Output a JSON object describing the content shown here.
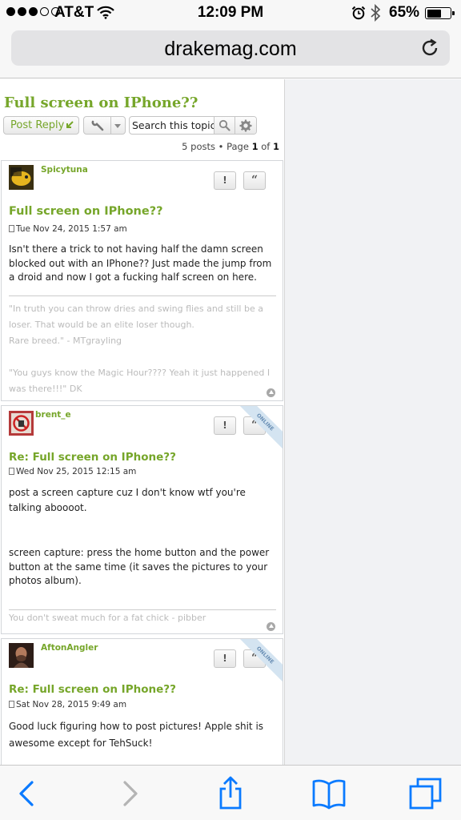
{
  "status_bar": {
    "carrier": "AT&T",
    "time": "12:09 PM",
    "battery_pct": "65%",
    "battery_level": 0.65,
    "signal_bars": 3,
    "signal_total": 5
  },
  "browser": {
    "url": "drakemag.com",
    "reload_icon": "reload-icon"
  },
  "topic": {
    "title": "Full screen on IPhone??",
    "post_reply": "Post Reply",
    "search_placeholder": "Search this topic…",
    "pagination": {
      "posts_text": "5 posts • Page ",
      "page": "1",
      "of_text": " of ",
      "total": "1"
    }
  },
  "report_label": "!",
  "quote_label": "“",
  "online_label": "ONLINE",
  "posts": [
    {
      "author": "Spicytuna",
      "title": "Full screen on IPhone??",
      "date": "Tue Nov 24, 2015 1:57 am",
      "body": [
        "Isn't there a trick to not having half the damn screen blocked out with an IPhone?? Just made the jump from a droid and now I got a fucking half screen on here."
      ],
      "signature": [
        "\"In truth you can throw dries and swing flies and still be a loser. That would be an elite loser though.",
        "Rare breed.\" - MTgrayling",
        "",
        "\"You guys know the Magic Hour???? Yeah it just happened I was there!!!\" DK"
      ]
    },
    {
      "author": "brent_e",
      "title": "Re: Full screen on IPhone??",
      "date": "Wed Nov 25, 2015 12:15 am",
      "body": [
        "post a screen capture cuz I don't know wtf you're talking aboooot.",
        "",
        "",
        "screen capture: press the home button and the power button at the same time (it saves the pictures to your photos album)."
      ],
      "signature": [
        "You don't sweat much for a fat chick - pibber"
      ]
    },
    {
      "author": "AftonAngler",
      "title": "Re: Full screen on IPhone??",
      "date": "Sat Nov 28, 2015 9:49 am",
      "body": [
        "Good luck figuring how to post pictures! Apple shit is awesome except for TehSuck!"
      ]
    }
  ],
  "colors": {
    "accent_green": "#76a62a",
    "ios_blue": "#0a7aff",
    "sidebar_bg": "#f1f2f4"
  }
}
